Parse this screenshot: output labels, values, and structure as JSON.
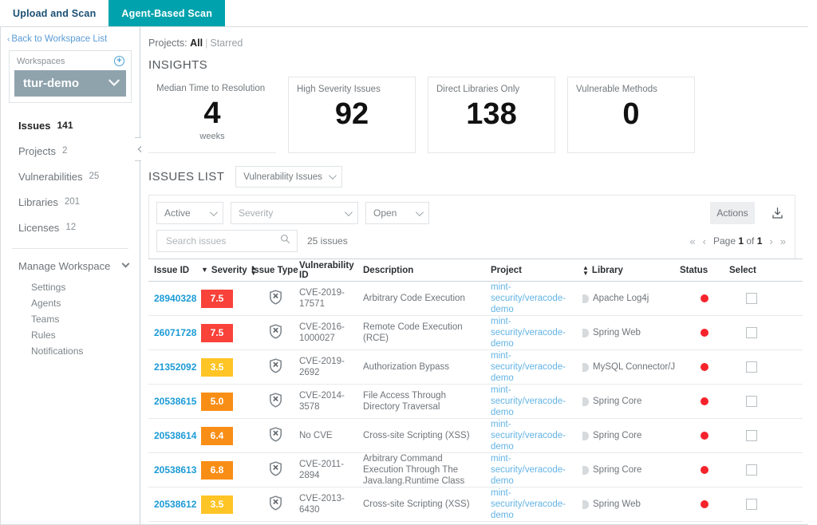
{
  "tabs": [
    {
      "label": "Upload and Scan",
      "active": false
    },
    {
      "label": "Agent-Based Scan",
      "active": true
    }
  ],
  "sidebar": {
    "back_link": "Back to Workspace List",
    "workspaces_label": "Workspaces",
    "add_icon": "plus-circle-icon",
    "selected_workspace": "ttur-demo",
    "nav": [
      {
        "label": "Issues",
        "count": "141",
        "active": true
      },
      {
        "label": "Projects",
        "count": "2",
        "active": false
      },
      {
        "label": "Vulnerabilities",
        "count": "25",
        "active": false
      },
      {
        "label": "Libraries",
        "count": "201",
        "active": false
      },
      {
        "label": "Licenses",
        "count": "12",
        "active": false
      }
    ],
    "manage_label": "Manage Workspace",
    "manage_items": [
      "Settings",
      "Agents",
      "Teams",
      "Rules",
      "Notifications"
    ]
  },
  "main": {
    "projects_prefix": "Projects:",
    "projects_value": "All",
    "projects_starred": "Starred",
    "insights_title": "INSIGHTS",
    "cards": [
      {
        "title": "Median Time to Resolution",
        "value": "4",
        "unit": "weeks",
        "bordered": false
      },
      {
        "title": "High Severity Issues",
        "value": "92",
        "unit": "",
        "bordered": true
      },
      {
        "title": "Direct Libraries Only",
        "value": "138",
        "unit": "",
        "bordered": true
      },
      {
        "title": "Vulnerable Methods",
        "value": "0",
        "unit": "",
        "bordered": true
      }
    ],
    "issues_list_title": "ISSUES LIST",
    "issue_kind_select": "Vulnerability Issues",
    "filters": [
      {
        "label": "Active",
        "placeholder": false
      },
      {
        "label": "Severity",
        "placeholder": true
      },
      {
        "label": "Open",
        "placeholder": false
      }
    ],
    "actions_label": "Actions",
    "download_icon": "download-icon",
    "search_placeholder": "Search issues",
    "search_value": "",
    "search_icon": "search-icon",
    "issue_count_label": "25 issues",
    "pager": {
      "first": "«",
      "prev": "‹",
      "page_word": "Page",
      "page": "1",
      "of_word": "of",
      "total": "1",
      "next": "›",
      "last": "»"
    }
  },
  "table": {
    "columns": [
      {
        "key": "issue_id",
        "label": "Issue ID",
        "sort": "none"
      },
      {
        "key": "severity",
        "label": "Severity",
        "sort": "desc-left"
      },
      {
        "key": "issue_type",
        "label": "Issue Type",
        "sort": "none"
      },
      {
        "key": "vulnerability_id",
        "label": "Vulnerability ID",
        "sort": "none"
      },
      {
        "key": "description",
        "label": "Description",
        "sort": "none"
      },
      {
        "key": "project",
        "label": "Project",
        "sort": "none"
      },
      {
        "key": "library",
        "label": "Library",
        "sort": "both"
      },
      {
        "key": "status",
        "label": "Status",
        "sort": "none"
      },
      {
        "key": "select",
        "label": "Select",
        "sort": "none"
      }
    ],
    "severity_colors": {
      "high": "#f8423a",
      "medium": "#f98e16",
      "low": "#ffc425"
    },
    "status_color": "#f5232c",
    "issue_type_icon": "shield-x-icon",
    "library_icon": "library-icon",
    "rows": [
      {
        "issue_id": "28940328",
        "severity": "7.5",
        "severity_level": "high",
        "issue_type_icon": "shield-x-icon",
        "vulnerability_id": "CVE-2019-17571",
        "description": "Arbitrary Code Execution",
        "project": "mint-security/veracode-demo",
        "library": "Apache Log4j",
        "status": "red",
        "selected": false
      },
      {
        "issue_id": "26071728",
        "severity": "7.5",
        "severity_level": "high",
        "issue_type_icon": "shield-x-icon",
        "vulnerability_id": "CVE-2016-1000027",
        "description": "Remote Code Execution (RCE)",
        "project": "mint-security/veracode-demo",
        "library": "Spring Web",
        "status": "red",
        "selected": false
      },
      {
        "issue_id": "21352092",
        "severity": "3.5",
        "severity_level": "low",
        "issue_type_icon": "shield-x-icon",
        "vulnerability_id": "CVE-2019-2692",
        "description": "Authorization Bypass",
        "project": "mint-security/veracode-demo",
        "library": "MySQL Connector/J",
        "status": "red",
        "selected": false
      },
      {
        "issue_id": "20538615",
        "severity": "5.0",
        "severity_level": "medium",
        "issue_type_icon": "shield-x-icon",
        "vulnerability_id": "CVE-2014-3578",
        "description": "File Access Through Directory Traversal",
        "project": "mint-security/veracode-demo",
        "library": "Spring Core",
        "status": "red",
        "selected": false
      },
      {
        "issue_id": "20538614",
        "severity": "6.4",
        "severity_level": "medium",
        "issue_type_icon": "shield-x-icon",
        "vulnerability_id": "No CVE",
        "description": "Cross-site Scripting (XSS)",
        "project": "mint-security/veracode-demo",
        "library": "Spring Core",
        "status": "red",
        "selected": false
      },
      {
        "issue_id": "20538613",
        "severity": "6.8",
        "severity_level": "medium",
        "issue_type_icon": "shield-x-icon",
        "vulnerability_id": "CVE-2011-2894",
        "description": "Arbitrary Command Execution Through The Java.lang.Runtime Class",
        "project": "mint-security/veracode-demo",
        "library": "Spring Core",
        "status": "red",
        "selected": false
      },
      {
        "issue_id": "20538612",
        "severity": "3.5",
        "severity_level": "low",
        "issue_type_icon": "shield-x-icon",
        "vulnerability_id": "CVE-2013-6430",
        "description": "Cross-site Scripting (XSS)",
        "project": "mint-security/veracode-demo",
        "library": "Spring Web",
        "status": "red",
        "selected": false
      }
    ]
  }
}
